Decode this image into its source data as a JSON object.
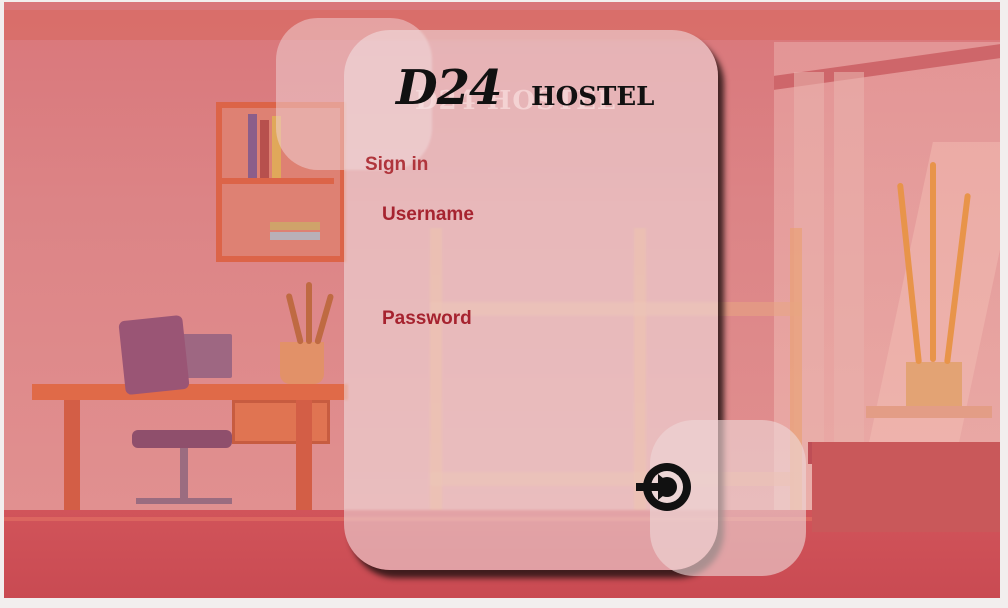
{
  "logo": {
    "main": "D24",
    "sub": "HOSTEL"
  },
  "form": {
    "heading": "Sign in",
    "username_label": "Username",
    "username_value": "",
    "password_label": "Password",
    "password_value": "",
    "submit_icon": "login-arrow-icon"
  },
  "colors": {
    "label": "#a6232f",
    "heading": "#b0353c",
    "card": "#f0e0e2",
    "background_tint": "#d97f7f"
  }
}
